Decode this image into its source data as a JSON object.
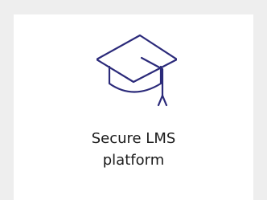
{
  "feature": {
    "icon": "graduation-cap-icon",
    "title_line1": "Secure LMS",
    "title_line2": "platform"
  },
  "colors": {
    "background": "#eeeeee",
    "card": "#ffffff",
    "icon_stroke": "#2b2a7a",
    "text": "#1a1a1a"
  }
}
